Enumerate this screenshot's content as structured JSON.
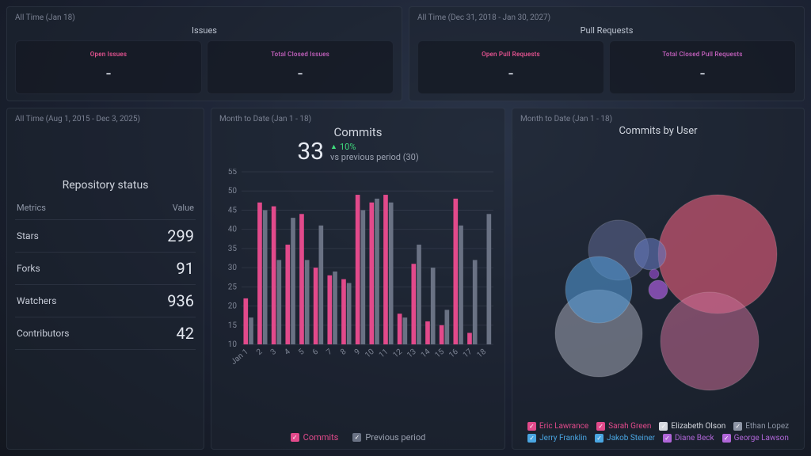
{
  "top": {
    "issues": {
      "time": "All Time (Jan 18)",
      "title": "Issues",
      "open_label": "Open Issues",
      "open_val": "-",
      "closed_label": "Total Closed Issues",
      "closed_val": "-"
    },
    "prs": {
      "time": "All Time (Dec 31, 2018 - Jan 30, 2027)",
      "title": "Pull Requests",
      "open_label": "Open Pull Requests",
      "open_val": "-",
      "closed_label": "Total Closed Pull Requests",
      "closed_val": "-"
    }
  },
  "repo": {
    "time": "All Time (Aug 1, 2015 - Dec 3, 2025)",
    "title": "Repository status",
    "col_metrics": "Metrics",
    "col_value": "Value",
    "rows": [
      {
        "k": "Stars",
        "v": "299"
      },
      {
        "k": "Forks",
        "v": "91"
      },
      {
        "k": "Watchers",
        "v": "936"
      },
      {
        "k": "Contributors",
        "v": "42"
      }
    ]
  },
  "commits": {
    "time": "Month to Date (Jan 1 - 18)",
    "title": "Commits",
    "value": "33",
    "delta": "10%",
    "prev_text": "vs previous period (30)",
    "legend_commits": "Commits",
    "legend_prev": "Previous period"
  },
  "users": {
    "time": "Month to Date (Jan 1 - 18)",
    "title": "Commits by User",
    "legend": [
      {
        "name": "Eric Lawrance",
        "color": "#e24a8b"
      },
      {
        "name": "Sarah Green",
        "color": "#e24a8b"
      },
      {
        "name": "Elizabeth Olson",
        "color": "#d6d9e0"
      },
      {
        "name": "Ethan Lopez",
        "color": "#8e96a6"
      },
      {
        "name": "Jerry Franklin",
        "color": "#4aa6e2"
      },
      {
        "name": "Jakob Steiner",
        "color": "#4aa6e2"
      },
      {
        "name": "Diane Beck",
        "color": "#b066d8"
      },
      {
        "name": "George Lawson",
        "color": "#b066d8"
      }
    ]
  },
  "chart_data": [
    {
      "type": "bar",
      "title": "Commits",
      "xlabel": "",
      "ylabel": "",
      "ylim": [
        10,
        55
      ],
      "categories": [
        "Jan 1",
        "2",
        "3",
        "4",
        "5",
        "6",
        "7",
        "8",
        "9",
        "10",
        "11",
        "12",
        "13",
        "14",
        "15",
        "16",
        "17",
        "18"
      ],
      "series": [
        {
          "name": "Commits",
          "values": [
            22,
            47,
            46,
            36,
            44,
            30,
            28,
            27,
            49,
            47,
            49,
            18,
            31,
            16,
            15,
            48,
            13,
            null
          ]
        },
        {
          "name": "Previous period",
          "values": [
            17,
            45,
            32,
            43,
            32,
            41,
            29,
            26,
            45,
            48,
            47,
            17,
            36,
            30,
            19,
            41,
            32,
            44
          ]
        }
      ]
    },
    {
      "type": "bubble",
      "title": "Commits by User",
      "series": [
        {
          "name": "Eric Lawrance",
          "value": 95,
          "color": "rgba(220,90,120,0.65)"
        },
        {
          "name": "Sarah Green",
          "value": 78,
          "color": "rgba(200,110,150,0.55)"
        },
        {
          "name": "Elizabeth Olson",
          "value": 60,
          "color": "rgba(150,155,170,0.6)"
        },
        {
          "name": "Ethan Lopez",
          "value": 40,
          "color": "rgba(90,100,140,0.6)"
        },
        {
          "name": "Jerry Franklin",
          "value": 45,
          "color": "rgba(80,150,210,0.6)"
        },
        {
          "name": "Jakob Steiner",
          "value": 18,
          "color": "rgba(100,120,190,0.6)"
        },
        {
          "name": "Diane Beck",
          "value": 12,
          "color": "rgba(160,90,210,0.75)"
        },
        {
          "name": "George Lawson",
          "value": 8,
          "color": "rgba(130,70,180,0.8)"
        }
      ]
    }
  ]
}
